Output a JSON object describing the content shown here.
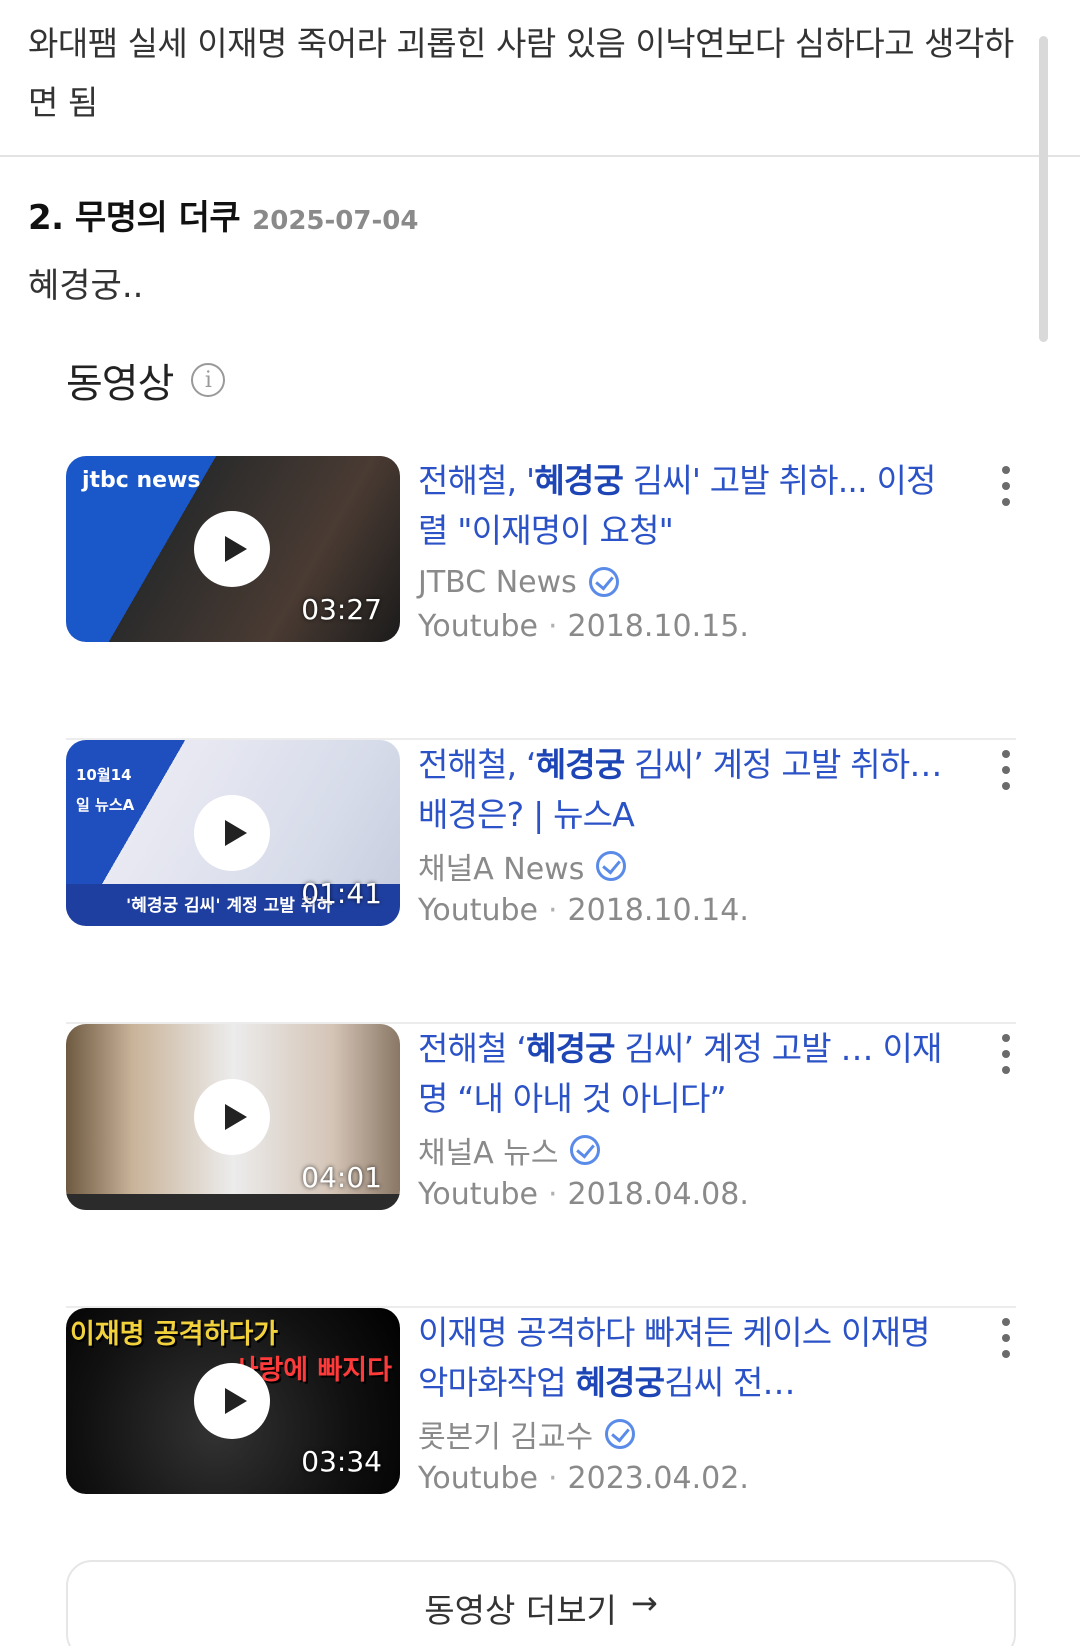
{
  "top_comment": {
    "text": "와대팸 실세 이재명 죽어라 괴롭힌 사람 있음 이낙연보다 심하다고 생각하면 됨"
  },
  "comment2": {
    "author": "2. 무명의 더쿠",
    "date": "2025-07-04",
    "body": "혜경궁.."
  },
  "videos_section": {
    "title": "동영상",
    "info_icon": "info-icon",
    "more_label": "동영상 더보기",
    "more_arrow": "→"
  },
  "videos": [
    {
      "title_pre": "전해철, '",
      "title_bold": "혜경궁",
      "title_post": " 김씨' 고발 취하... 이정렬 \"이재명이 요청\"",
      "duration": "03:27",
      "channel": "JTBC News",
      "source": "Youtube",
      "date": "2018.10.15.",
      "thumb_logo": "jtbc news"
    },
    {
      "title_pre": "전해철, ‘",
      "title_bold": "혜경궁",
      "title_post": " 김씨’ 계정 고발 취하…배경은? | 뉴스A",
      "duration": "01:41",
      "channel": "채널A News",
      "source": "Youtube",
      "date": "2018.10.14.",
      "thumb_logo": "10월14일 뉴스A",
      "thumb_caption": "'혜경궁 김씨' 계정 고발 취하"
    },
    {
      "title_pre": "전해철 ‘",
      "title_bold": "혜경궁",
      "title_post": " 김씨’ 계정 고발 … 이재명 “내 아내 것 아니다”",
      "duration": "04:01",
      "channel": "채널A 뉴스",
      "source": "Youtube",
      "date": "2018.04.08."
    },
    {
      "title_pre": "이재명 공격하다 빠져든 케이스 이재명 악마화작업 ",
      "title_bold": "혜경궁",
      "title_post": "김씨 전…",
      "duration": "03:34",
      "channel": "롯본기 김교수",
      "source": "Youtube",
      "date": "2023.04.02.",
      "thumb_caption_top": "이재명 공격하다가",
      "thumb_caption_mid": "사랑에 빠지다"
    }
  ],
  "colors": {
    "link_blue": "#2b52c6",
    "meta_gray": "#8a8a8a",
    "verified_blue": "#5a8be8"
  }
}
